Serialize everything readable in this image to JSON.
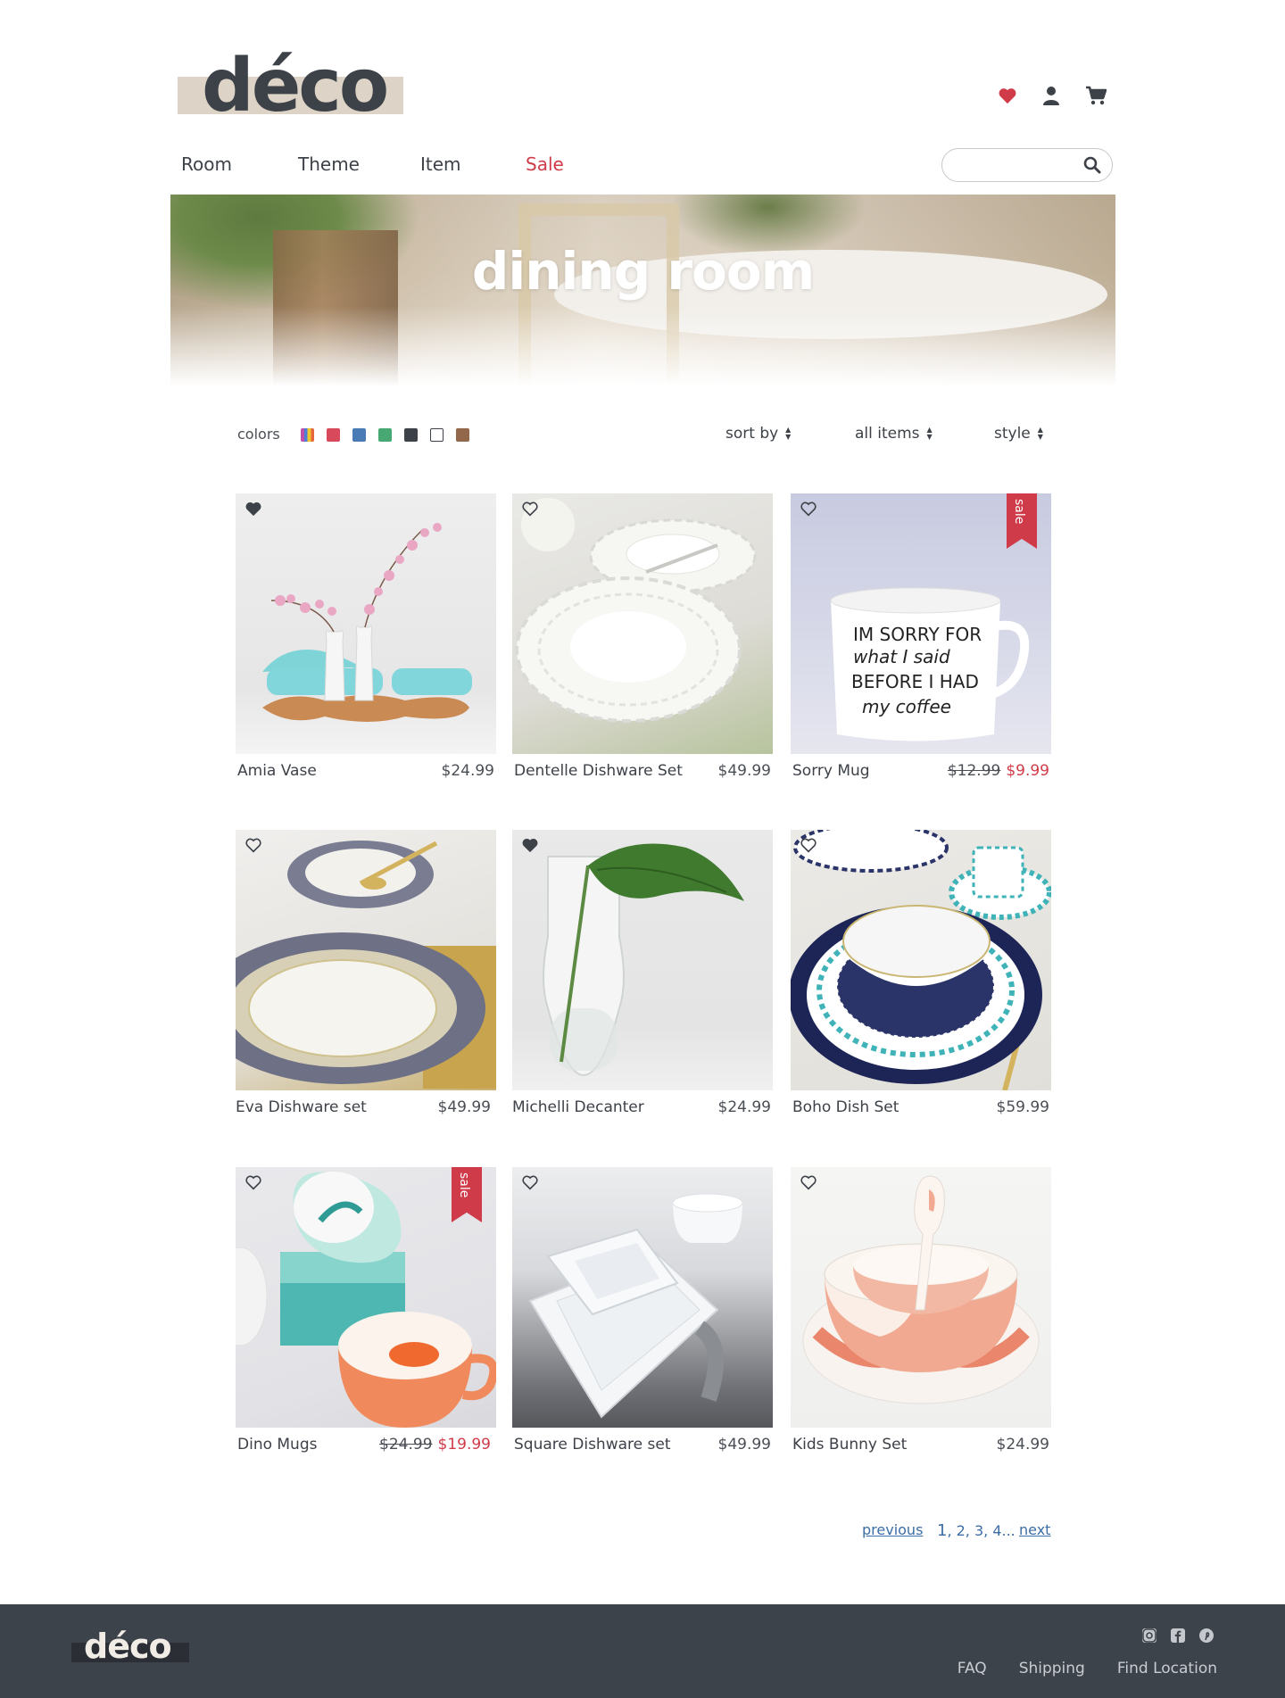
{
  "brand": {
    "name": "déco",
    "accent": "#d03b49",
    "dark": "#3d4148",
    "logo_bar": "#ddd3c6"
  },
  "nav": {
    "room": "Room",
    "theme": "Theme",
    "item": "Item",
    "sale": "Sale"
  },
  "search": {
    "placeholder": ""
  },
  "hero": {
    "title": "dining room"
  },
  "filters": {
    "colors_label": "colors",
    "swatches": [
      "multicolor",
      "#d84a5b",
      "#4a7bb5",
      "#47a874",
      "#3d4148",
      "#ffffff",
      "#93684a"
    ],
    "sort_by": "sort by",
    "all_items": "all items",
    "style": "style"
  },
  "products": [
    {
      "name": "Amia Vase",
      "price": "$24.99",
      "favorited": true
    },
    {
      "name": "Dentelle Dishware Set",
      "price": "$49.99",
      "favorited": false
    },
    {
      "name": "Sorry Mug",
      "old_price": "$12.99",
      "price": "$9.99",
      "sale": true,
      "favorited": false
    },
    {
      "name": "Eva Dishware set",
      "price": "$49.99",
      "favorited": false
    },
    {
      "name": "Michelli Decanter",
      "price": "$24.99",
      "favorited": true
    },
    {
      "name": "Boho Dish Set",
      "price": "$59.99",
      "favorited": false
    },
    {
      "name": "Dino Mugs",
      "old_price": "$24.99",
      "price": "$19.99",
      "sale": true,
      "favorited": false
    },
    {
      "name": "Square Dishware set",
      "price": "$49.99",
      "favorited": false
    },
    {
      "name": "Kids Bunny Set",
      "price": "$24.99",
      "favorited": false
    }
  ],
  "sale_badge": "sale",
  "mug_text": "IM SORRY FOR what I said BEFORE I HAD my coffee",
  "pagination": {
    "previous": "previous",
    "current": "1",
    "pages": ", 2, 3, 4...",
    "next": "next"
  },
  "footer": {
    "brand": "déco",
    "social": [
      "instagram-icon",
      "facebook-icon",
      "pinterest-icon"
    ],
    "links": [
      "FAQ",
      "Shipping",
      "Find Location"
    ]
  }
}
